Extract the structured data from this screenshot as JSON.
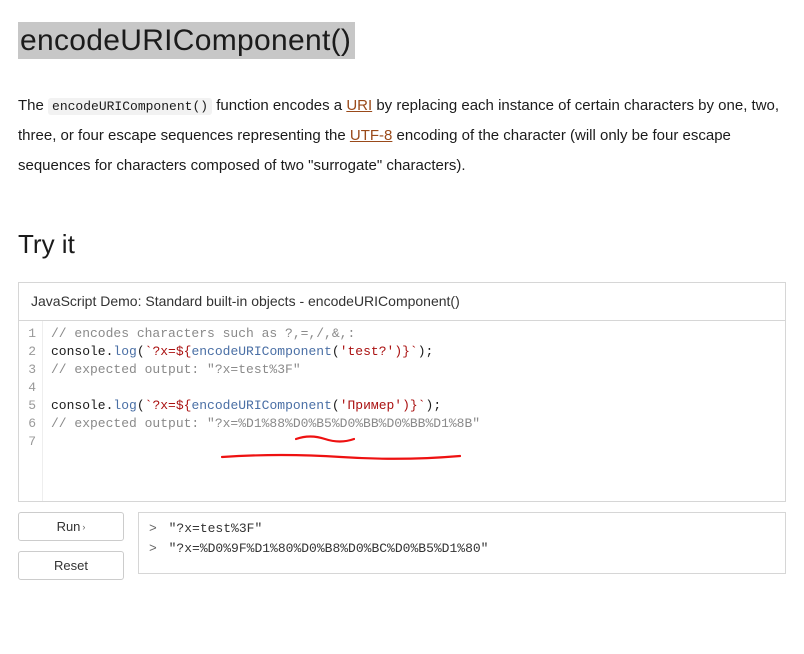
{
  "heading": "encodeURIComponent()",
  "description": {
    "pre": "The ",
    "code": "encodeURIComponent()",
    "mid1": " function encodes a ",
    "link1": "URI",
    "mid2": " by replacing each instance of certain characters by one, two, three, or four escape sequences representing the ",
    "link2": "UTF-8",
    "mid3": " encoding of the character (will only be four escape sequences for characters composed of two \"surrogate\" characters)."
  },
  "tryit_heading": "Try it",
  "demo": {
    "title": "JavaScript Demo: Standard built-in objects - encodeURIComponent()",
    "gutter": [
      "1",
      "2",
      "3",
      "4",
      "5",
      "6",
      "7"
    ],
    "lines": {
      "l1_comment": "// encodes characters such as ?,=,/,&,:",
      "l2": {
        "a": "console",
        "b": ".",
        "c": "log",
        "d": "(",
        "e": "`?x=${",
        "f": "encodeURIComponent",
        "g": "(",
        "h": "'test?'",
        "i": ")}",
        "j": "`",
        "k": ");"
      },
      "l3_comment": "// expected output: \"?x=test%3F\"",
      "l5": {
        "a": "console",
        "b": ".",
        "c": "log",
        "d": "(",
        "e": "`?x=${",
        "f": "encodeURIComponent",
        "g": "(",
        "h": "'Пример'",
        "i": ")}",
        "j": "`",
        "k": ");"
      },
      "l6_comment": "// expected output: \"?x=%D1%88%D0%B5%D0%BB%D0%BB%D1%8B\""
    }
  },
  "buttons": {
    "run": "Run",
    "reset": "Reset"
  },
  "output": {
    "line1": "\"?x=test%3F\"",
    "line2": "\"?x=%D0%9F%D1%80%D0%B8%D0%BC%D0%B5%D1%80\""
  }
}
